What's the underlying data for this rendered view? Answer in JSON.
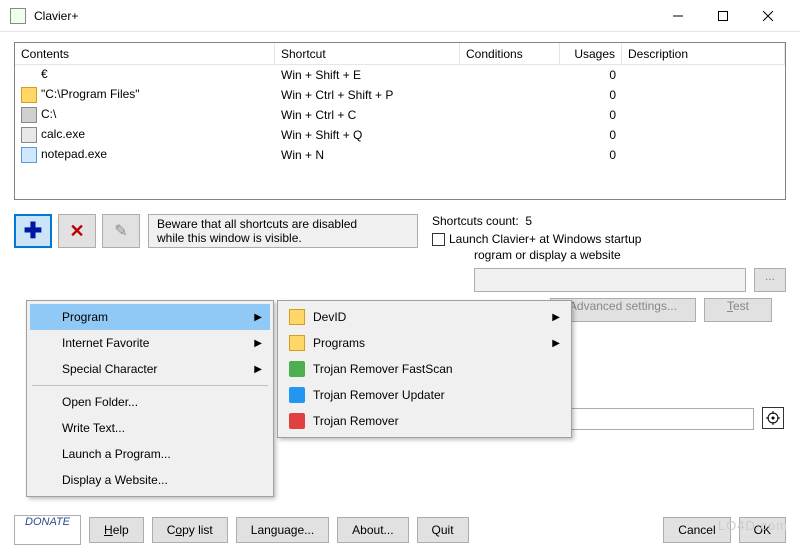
{
  "window": {
    "title": "Clavier+"
  },
  "table": {
    "headers": {
      "contents": "Contents",
      "shortcut": "Shortcut",
      "conditions": "Conditions",
      "usages": "Usages",
      "description": "Description"
    },
    "rows": [
      {
        "icon": "euro",
        "contents": "€",
        "shortcut": "Win + Shift + E",
        "conditions": "",
        "usages": "0",
        "description": ""
      },
      {
        "icon": "folder",
        "contents": "\"C:\\Program Files\"",
        "shortcut": "Win + Ctrl + Shift + P",
        "conditions": "",
        "usages": "0",
        "description": ""
      },
      {
        "icon": "drive",
        "contents": "C:\\",
        "shortcut": "Win + Ctrl + C",
        "conditions": "",
        "usages": "0",
        "description": ""
      },
      {
        "icon": "calc",
        "contents": "calc.exe",
        "shortcut": "Win + Shift + Q",
        "conditions": "",
        "usages": "0",
        "description": ""
      },
      {
        "icon": "notepad",
        "contents": "notepad.exe",
        "shortcut": "Win + N",
        "conditions": "",
        "usages": "0",
        "description": ""
      }
    ]
  },
  "warning": {
    "line1": "Beware that all shortcuts are disabled",
    "line2": "while this window is visible."
  },
  "shortcuts_count_label": "Shortcuts count:",
  "shortcuts_count_value": "5",
  "startup_label": "Launch Clavier+ at Windows startup",
  "menu1": {
    "program": "Program",
    "internet_favorite": "Internet Favorite",
    "special_character": "Special Character",
    "open_folder": "Open Folder...",
    "write_text": "Write Text...",
    "launch_program": "Launch a Program...",
    "display_website": "Display a Website..."
  },
  "menu2": {
    "devid": "DevID",
    "programs": "Programs",
    "trojan_fastscan": "Trojan Remover FastScan",
    "trojan_updater": "Trojan Remover Updater",
    "trojan_remover": "Trojan Remover"
  },
  "radio_label": "rogram or display a website",
  "browse_label": "...",
  "advanced_label": "Advanced settings...",
  "test_label": "Test",
  "buttons": {
    "donate": "DONATE",
    "help": "Help",
    "copy_list": "Copy list",
    "language": "Language...",
    "about": "About...",
    "quit": "Quit",
    "cancel": "Cancel",
    "ok": "OK"
  },
  "watermark": "LO4D.com"
}
